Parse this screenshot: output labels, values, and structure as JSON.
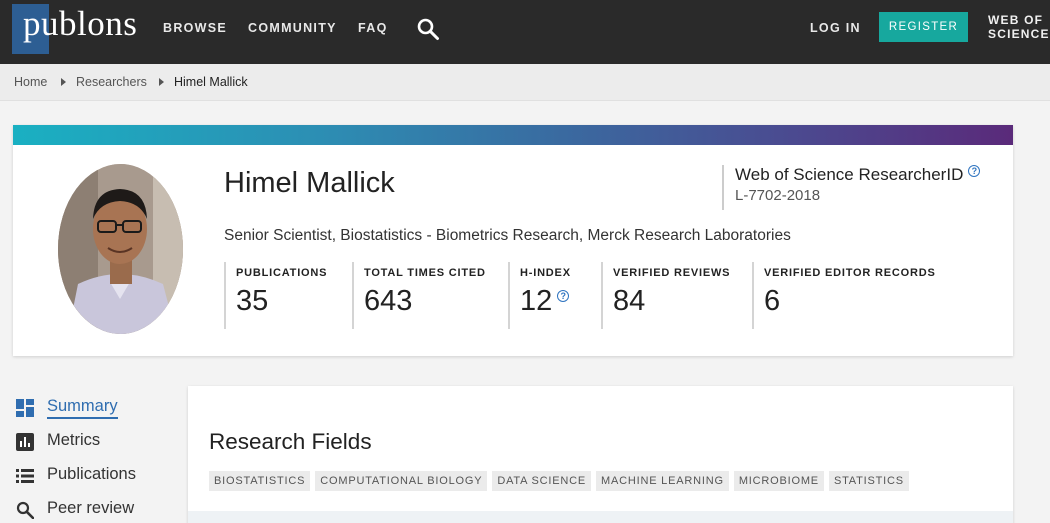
{
  "brand": {
    "logo_text": "publons",
    "accent": "#17a89e",
    "nav_bg": "#2a2a2a"
  },
  "nav": {
    "browse": "BROWSE",
    "community": "COMMUNITY",
    "faq": "FAQ",
    "search_icon": "search-icon",
    "login": "LOG IN",
    "register": "REGISTER",
    "wos_line1": "WEB OF",
    "wos_line2": "SCIENCE"
  },
  "breadcrumb": [
    "Home",
    "Researchers",
    "Himel Mallick"
  ],
  "profile": {
    "name": "Himel Mallick",
    "position": "Senior Scientist, Biostatistics - Biometrics Research, Merck Research Laboratories",
    "wos_title": "Web of Science ResearcherID",
    "wos_id": "L-7702-2018",
    "help_glyph": "?",
    "stats": [
      {
        "label": "PUBLICATIONS",
        "value": "35"
      },
      {
        "label": "TOTAL TIMES CITED",
        "value": "643"
      },
      {
        "label": "H-INDEX",
        "value": "12"
      },
      {
        "label": "VERIFIED REVIEWS",
        "value": "84"
      },
      {
        "label": "VERIFIED EDITOR RECORDS",
        "value": "6"
      }
    ]
  },
  "sidebar": {
    "items": [
      {
        "label": "Summary",
        "icon": "dashboard-icon",
        "active": true
      },
      {
        "label": "Metrics",
        "icon": "bar-chart-icon",
        "active": false
      },
      {
        "label": "Publications",
        "icon": "list-icon",
        "active": false
      },
      {
        "label": "Peer review",
        "icon": "search-icon",
        "active": false
      }
    ]
  },
  "research_fields": {
    "title": "Research Fields",
    "tags": [
      "BIOSTATISTICS",
      "COMPUTATIONAL BIOLOGY",
      "DATA SCIENCE",
      "MACHINE LEARNING",
      "MICROBIOME",
      "STATISTICS"
    ]
  }
}
